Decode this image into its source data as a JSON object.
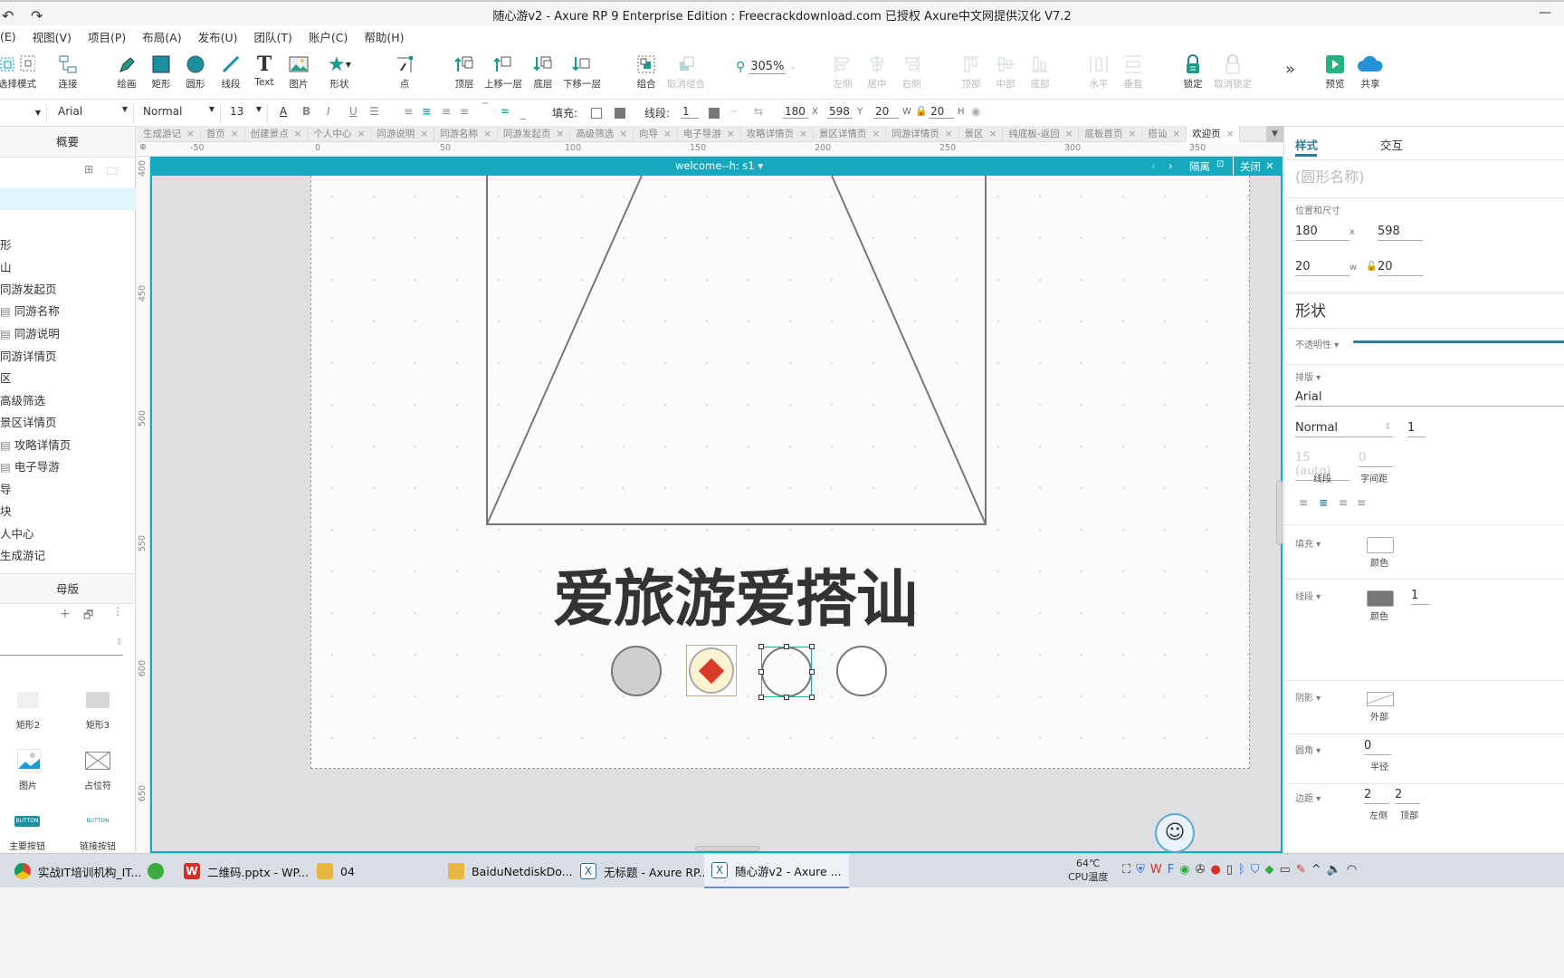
{
  "window": {
    "title": "随心游v2 - Axure RP 9 Enterprise Edition : Freecrackdownload.com 已授权    Axure中文网提供汉化 V7.2",
    "undo_icon": "undo-icon",
    "redo_icon": "redo-icon",
    "minimize": "—"
  },
  "menu": [
    "(E)",
    "视图(V)",
    "项目(P)",
    "布局(A)",
    "发布(U)",
    "团队(T)",
    "账户(C)",
    "帮助(H)"
  ],
  "toolbar": {
    "items": [
      {
        "label": "选择模式",
        "icon": "select-mode-icon"
      },
      {
        "label": "连接",
        "icon": "connect-icon"
      },
      {
        "label": "绘画",
        "icon": "pen-icon"
      },
      {
        "label": "矩形",
        "icon": "rectangle-icon"
      },
      {
        "label": "圆形",
        "icon": "circle-icon"
      },
      {
        "label": "线段",
        "icon": "line-icon"
      },
      {
        "label": "Text",
        "icon": "text-icon"
      },
      {
        "label": "图片",
        "icon": "image-icon"
      },
      {
        "label": "形状",
        "icon": "star-icon"
      },
      {
        "label": "点",
        "icon": "point-icon"
      },
      {
        "label": "顶层",
        "icon": "bring-to-front-icon"
      },
      {
        "label": "上移一层",
        "icon": "bring-forward-icon"
      },
      {
        "label": "底层",
        "icon": "send-to-back-icon"
      },
      {
        "label": "下移一层",
        "icon": "send-backward-icon"
      },
      {
        "label": "组合",
        "icon": "group-icon"
      },
      {
        "label": "取消组合",
        "icon": "ungroup-icon"
      },
      {
        "label": "左侧",
        "icon": "align-left-icon"
      },
      {
        "label": "居中",
        "icon": "align-center-icon"
      },
      {
        "label": "右侧",
        "icon": "align-right-icon"
      },
      {
        "label": "顶部",
        "icon": "align-top-icon"
      },
      {
        "label": "中部",
        "icon": "align-middle-icon"
      },
      {
        "label": "底部",
        "icon": "align-bottom-icon"
      },
      {
        "label": "水平",
        "icon": "distribute-horizontal-icon"
      },
      {
        "label": "垂直",
        "icon": "distribute-vertical-icon"
      },
      {
        "label": "锁定",
        "icon": "lock-icon"
      },
      {
        "label": "取消锁定",
        "icon": "unlock-icon"
      },
      {
        "label": "预览",
        "icon": "preview-icon"
      },
      {
        "label": "共享",
        "icon": "share-cloud-icon"
      }
    ],
    "zoom": "305%",
    "more": "»"
  },
  "format": {
    "font": "Arial",
    "weight": "Normal",
    "size": "13",
    "fill_label": "填充:",
    "stroke_label": "线段:",
    "stroke_width": "1",
    "x": "180",
    "x_label": "X",
    "y": "598",
    "y_label": "Y",
    "w": "20",
    "w_label": "W",
    "h": "20",
    "h_label": "H"
  },
  "left_panel": {
    "outline_title": "概要",
    "pages": [
      "形",
      "山",
      "同游发起页",
      "同游名称",
      "同游说明",
      "同游详情页",
      "区",
      "高级筛选",
      "景区详情页",
      "攻略详情页",
      "电子导游",
      "导",
      "块",
      "人中心",
      "生成游记"
    ],
    "masters_title": "母版",
    "widgets": [
      {
        "label": "矩形2"
      },
      {
        "label": "矩形3"
      },
      {
        "label": "图片"
      },
      {
        "label": "占位符"
      },
      {
        "label": "主要按钮",
        "thumb": "BUTTON"
      },
      {
        "label": "链接按钮",
        "thumb": "BUTTON"
      }
    ]
  },
  "tabs": [
    {
      "label": "生成游记"
    },
    {
      "label": "首页"
    },
    {
      "label": "创建景点"
    },
    {
      "label": "个人中心"
    },
    {
      "label": "同游说明"
    },
    {
      "label": "同游名称"
    },
    {
      "label": "同游发起页"
    },
    {
      "label": "高级筛选"
    },
    {
      "label": "向导"
    },
    {
      "label": "电子导游"
    },
    {
      "label": "攻略详情页"
    },
    {
      "label": "景区详情页"
    },
    {
      "label": "同游详情页"
    },
    {
      "label": "景区"
    },
    {
      "label": "纯底板-返回"
    },
    {
      "label": "底板首页"
    },
    {
      "label": "搭讪"
    },
    {
      "label": "欢迎页",
      "active": true
    }
  ],
  "ruler": {
    "h_ticks": [
      "-50",
      "0",
      "50",
      "100",
      "150",
      "200",
      "250",
      "300",
      "350"
    ],
    "v_ticks": [
      "400",
      "450",
      "500",
      "550",
      "600",
      "650"
    ]
  },
  "canvas_bar": {
    "state": "welcome--h: s1 ▾",
    "isolate": "隔离",
    "close": "关闭"
  },
  "canvas": {
    "heading": "爱旅游爱搭讪"
  },
  "right_panel": {
    "tab_style": "样式",
    "tab_interact": "交互",
    "name_placeholder": "(圆形名称)",
    "pos_size_label": "位置和尺寸",
    "x": "180",
    "x_label": "x",
    "y": "598",
    "w": "20",
    "w_label": "w",
    "h": "20",
    "shape_title": "形状",
    "opacity_label": "不透明性 ▾",
    "typography_label": "排版 ▾",
    "font": "Arial",
    "weight": "Normal",
    "line_height": "15 (auto)",
    "line_height_label": "线段",
    "letter_spacing": "0",
    "letter_spacing_label": "字间距",
    "fill_label": "填充 ▾",
    "fill_color_label": "颜色",
    "stroke_label": "线段 ▾",
    "stroke_color_label": "颜色",
    "stroke_width": "1",
    "shadow_label": "阴影 ▾",
    "shadow_outer_label": "外部",
    "radius_label": "圆角 ▾",
    "radius": "0",
    "radius_sub": "半径",
    "padding_label": "边距 ▾",
    "padding_left": "2",
    "padding_left_label": "左侧",
    "padding_top": "2",
    "padding_top_label": "顶部",
    "accent": "#16a9bd"
  },
  "taskbar": {
    "items": [
      {
        "label": "实战IT培训机构_IT...",
        "icon": "chrome-icon"
      },
      {
        "label": "",
        "icon": "browser-icon"
      },
      {
        "label": "二维码.pptx - WP...",
        "icon": "wps-icon"
      },
      {
        "label": "04",
        "icon": "folder-icon"
      },
      {
        "label": "BaiduNetdiskDo...",
        "icon": "folder-icon"
      },
      {
        "label": "无标题 - Axure RP...",
        "icon": "axure-icon"
      },
      {
        "label": "随心游v2 - Axure ...",
        "icon": "axure-icon",
        "active": true
      }
    ],
    "temp": "64℃",
    "temp_label": "CPU温度"
  }
}
